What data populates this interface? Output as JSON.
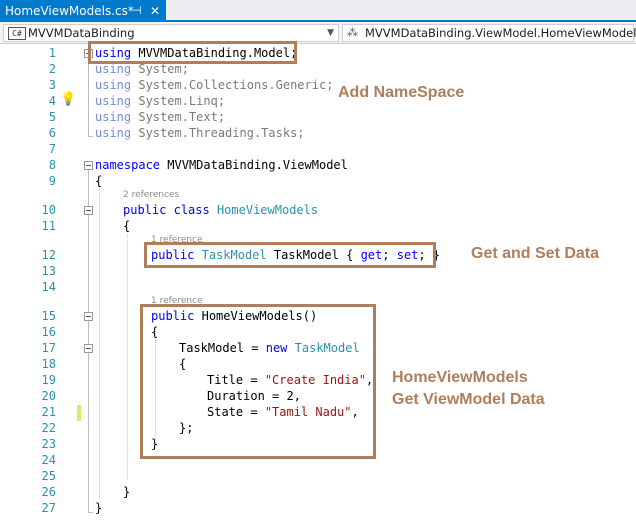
{
  "tab": {
    "title": "HomeViewModels.cs*",
    "pin_icon": "pin-icon",
    "close_icon": "close-icon"
  },
  "navbar": {
    "project": "MVVMDataBinding",
    "scope": "MVVMDataBinding.ViewModel.HomeViewModels",
    "badge": "C#"
  },
  "line_numbers": [
    "1",
    "2",
    "3",
    "4",
    "5",
    "6",
    "7",
    "8",
    "9",
    "10",
    "11",
    "12",
    "13",
    "14",
    "15",
    "16",
    "17",
    "18",
    "19",
    "20",
    "21",
    "22",
    "23",
    "24",
    "25",
    "26",
    "27"
  ],
  "code": {
    "l1_kw": "using",
    "l1_ns": "MVVMDataBinding.Model;",
    "l2_kw": "using",
    "l2_ns": "System;",
    "l3_kw": "using",
    "l3_ns": "System.Collections.Generic;",
    "l4_kw": "using",
    "l4_ns": "System.Linq;",
    "l5_kw": "using",
    "l5_ns": "System.Text;",
    "l6_kw": "using",
    "l6_ns": "System.Threading.Tasks;",
    "l8_kw": "namespace",
    "l8_ns": "MVVMDataBinding.ViewModel",
    "open_brace": "{",
    "close_brace": "}",
    "ref2": "2 references",
    "ref1a": "1 reference",
    "ref1b": "1 reference",
    "l10_kw1": "public",
    "l10_kw2": "class",
    "l10_ty": "HomeViewModels",
    "l12_kw": "public",
    "l12_ty": "TaskModel",
    "l12_name": "TaskModel {",
    "l12_get": "get",
    "l12_set": "set",
    "l15_kw": "public",
    "l15_name": "HomeViewModels()",
    "l17_a": "TaskModel =",
    "l17_kw": "new",
    "l17_ty": "TaskModel",
    "l19_a": "Title =",
    "l19_str": "\"Create India\"",
    "l20": "Duration = 2,",
    "l21_a": "State =",
    "l21_str": "\"Tamil Nadu\"",
    "l22": "};"
  },
  "annotations": {
    "namespace": "Add NameSpace",
    "getset": "Get and Set Data",
    "ctor_1": "HomeViewModels",
    "ctor_2": "Get ViewModel Data"
  },
  "colors": {
    "accent": "#007acc",
    "annotation": "#b07e5a",
    "keyword": "#0000ff",
    "type": "#2b91af",
    "string": "#a31515"
  }
}
